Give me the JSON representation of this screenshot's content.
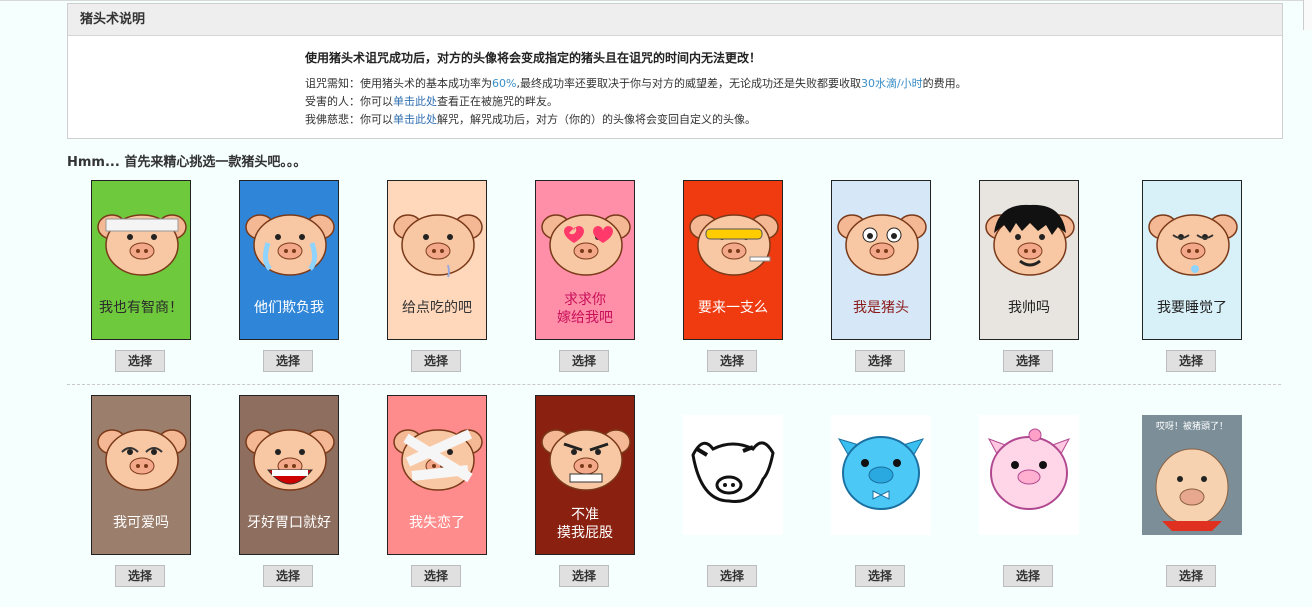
{
  "panel": {
    "title": "猪头术说明",
    "warning": "使用猪头术诅咒成功后，对方的头像将会变成指定的猪头且在诅咒的时间内无法更改！",
    "line1": {
      "a": "诅咒需知：使用猪头术的基本成功率为",
      "rate": "60%",
      "b": ",最终成功率还要取决于你与对方的威望差，无论成功还是失败都要收取",
      "cost": "30水滴/小时",
      "c": "的费用。"
    },
    "line2": {
      "a": "受害的人：你可以",
      "link": "单击此处",
      "b": "查看正在被施咒的畔友。"
    },
    "line3": {
      "a": "我佛慈悲：你可以",
      "link": "单击此处",
      "b": "解咒，解咒成功后，对方（你的）的头像将会变回自定义的头像。"
    }
  },
  "intro": "Hmm... 首先来精心挑选一款猪头吧。。。",
  "select_label": "选择",
  "pigs_row1": [
    {
      "caption": "我也有智商！",
      "bg": "#6fc93c",
      "capColor": "#2a2a2a",
      "accessory": "headband-icon"
    },
    {
      "caption": "他们欺负我",
      "bg": "#2f86d8",
      "capColor": "#ffffff",
      "accessory": "tears-icon"
    },
    {
      "caption": "给点吃的吧",
      "bg": "#ffd8bc",
      "capColor": "#333333",
      "accessory": "drool-icon"
    },
    {
      "caption": "求求你\n嫁给我吧",
      "bg": "#ff8fa8",
      "capColor": "#c8105a",
      "accessory": "heart-eyes-icon"
    },
    {
      "caption": "要来一支么",
      "bg": "#f03a10",
      "capColor": "#ffffff",
      "accessory": "sunglasses-icon"
    },
    {
      "caption": "我是猪头",
      "bg": "#d6e8f7",
      "capColor": "#8a1a1a",
      "accessory": "silly-face-icon"
    },
    {
      "caption": "我帅吗",
      "bg": "#e8e4e0",
      "capColor": "#222222",
      "accessory": "hair-icon"
    },
    {
      "caption": "我要睡觉了",
      "bg": "#d8f0f8",
      "capColor": "#222222",
      "accessory": "sleepy-icon"
    }
  ],
  "pigs_row2": [
    {
      "caption": "我可爱吗",
      "bg": "#9b7e6c",
      "capColor": "#ffffff",
      "accessory": "happy-eyes-icon"
    },
    {
      "caption": "牙好胃口就好",
      "bg": "#8e6e5e",
      "capColor": "#ffffff",
      "accessory": "big-mouth-icon"
    },
    {
      "caption": "我失恋了",
      "bg": "#ff8c8c",
      "capColor": "#ffffff",
      "accessory": "bandage-icon"
    },
    {
      "caption": "不准\n摸我屁股",
      "bg": "#8a2010",
      "capColor": "#ffffff",
      "accessory": "angry-icon"
    },
    {
      "caption": "",
      "bg": "",
      "capColor": "",
      "accessory": "ink-sketch-pig-icon"
    },
    {
      "caption": "",
      "bg": "",
      "capColor": "",
      "accessory": "blue-pig-icon"
    },
    {
      "caption": "",
      "bg": "",
      "capColor": "",
      "accessory": "pink-pig-icon"
    },
    {
      "caption": "哎呀！被猪頭了！",
      "bg": "#7c8f99",
      "capColor": "#ffffff",
      "accessory": "cartoon-pig-icon"
    }
  ]
}
